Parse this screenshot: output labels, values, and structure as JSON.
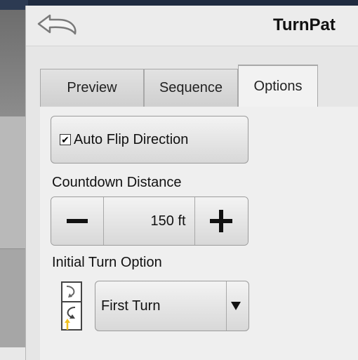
{
  "window": {
    "title": "TurnPat"
  },
  "icons": {
    "back": "back-arrow-icon",
    "turn_option": "turn-direction-icon",
    "dropdown": "triangle-down-icon"
  },
  "tabs": [
    {
      "label": "Preview",
      "active": false
    },
    {
      "label": "Sequence",
      "active": false
    },
    {
      "label": "Options",
      "active": true
    }
  ],
  "options": {
    "auto_flip": {
      "label": "Auto Flip Direction",
      "checked": true
    },
    "countdown": {
      "label": "Countdown Distance",
      "value": "150 ft"
    },
    "initial_turn": {
      "label": "Initial Turn Option",
      "selected": "First Turn"
    }
  },
  "colors": {
    "accent_tab": "#8ab0d6",
    "turn_arrow": "#f0c020"
  }
}
